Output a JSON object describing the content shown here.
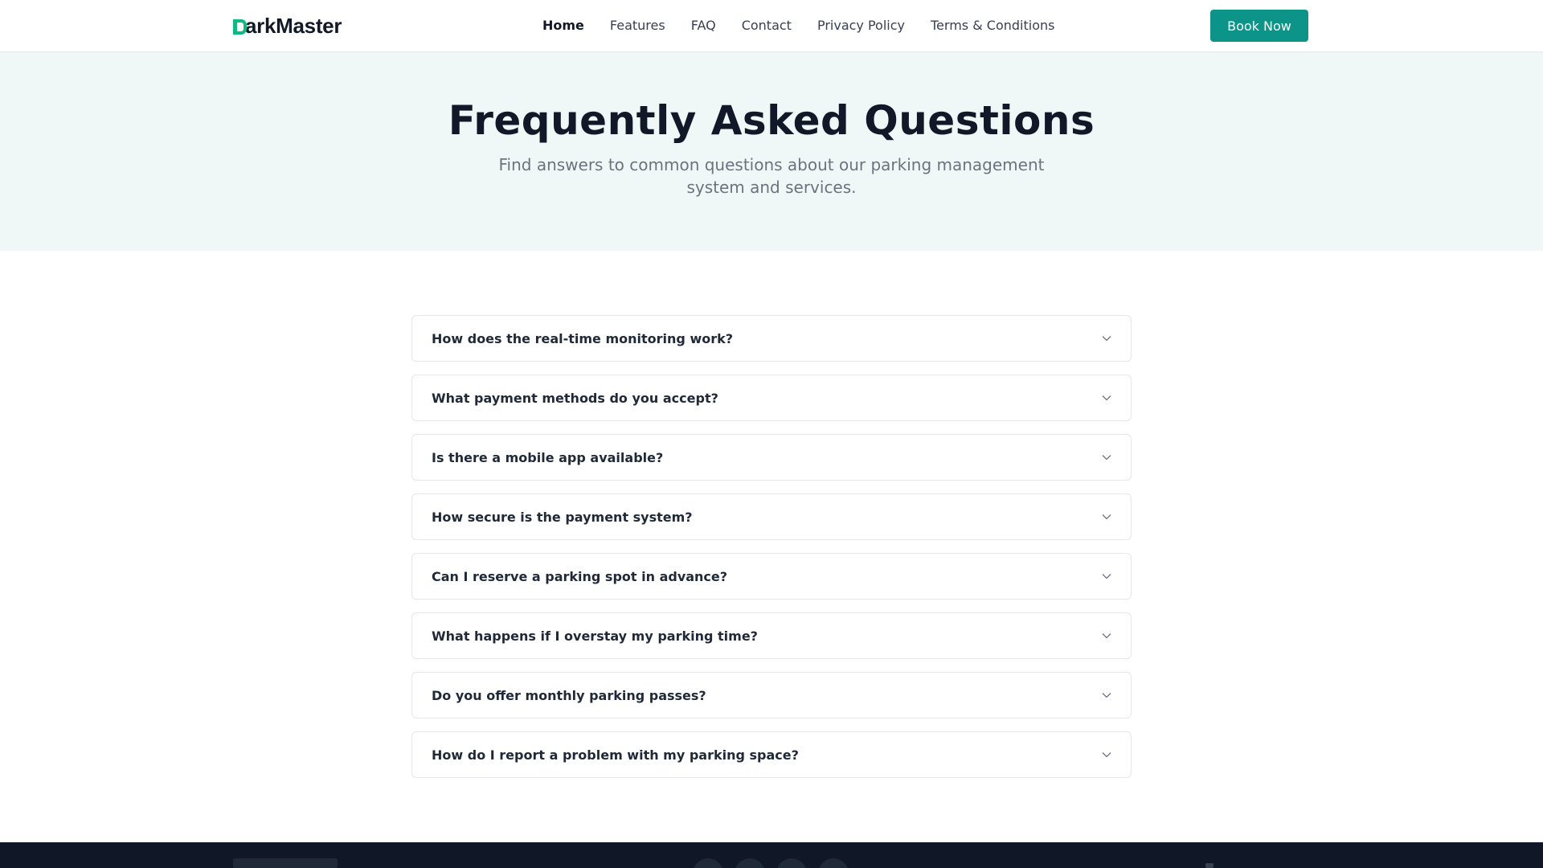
{
  "brand": {
    "name": "ParkMaster",
    "name_rest": "arkMaster",
    "accent": "#10b981"
  },
  "nav": {
    "items": [
      {
        "label": "Home",
        "active": true
      },
      {
        "label": "Features",
        "active": false
      },
      {
        "label": "FAQ",
        "active": false
      },
      {
        "label": "Contact",
        "active": false
      },
      {
        "label": "Privacy Policy",
        "active": false
      },
      {
        "label": "Terms & Conditions",
        "active": false
      }
    ],
    "cta_label": "Book Now",
    "cta_color": "#0d9488"
  },
  "hero": {
    "title": "Frequently Asked Questions",
    "subtitle": "Find answers to common questions about our parking management system and services.",
    "background": "#f0f8f7"
  },
  "faq": {
    "items": [
      {
        "question": "How does the real-time monitoring work?",
        "icon": "chevron-down-icon"
      },
      {
        "question": "What payment methods do you accept?",
        "icon": "chevron-down-icon"
      },
      {
        "question": "Is there a mobile app available?",
        "icon": "chevron-down-icon"
      },
      {
        "question": "How secure is the payment system?",
        "icon": "chevron-down-icon"
      },
      {
        "question": "Can I reserve a parking spot in advance?",
        "icon": "chevron-down-icon"
      },
      {
        "question": "What happens if I overstay my parking time?",
        "icon": "chevron-down-icon"
      },
      {
        "question": "Do you offer monthly parking passes?",
        "icon": "chevron-down-icon"
      },
      {
        "question": "How do I report a problem with my parking space?",
        "icon": "chevron-down-icon"
      }
    ]
  },
  "footer": {
    "background": "#101827"
  }
}
